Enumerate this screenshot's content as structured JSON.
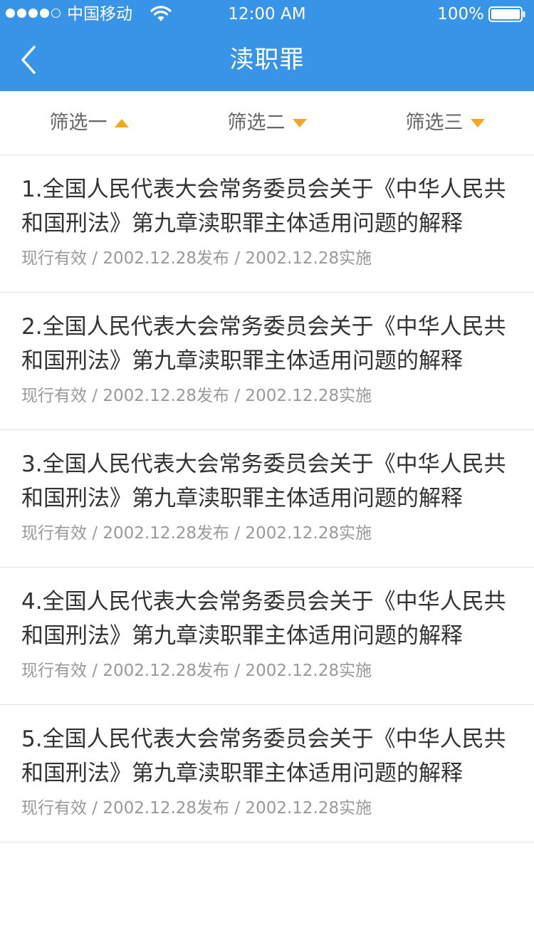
{
  "status_bar": {
    "carrier": "中国移动",
    "time": "12:00 AM",
    "battery": "100%"
  },
  "nav": {
    "title": "渎职罪",
    "back_icon": "chevron-left-icon"
  },
  "filters": [
    {
      "label": "筛选一",
      "icon": "triangle-up-icon"
    },
    {
      "label": "筛选二",
      "icon": "triangle-down-icon"
    },
    {
      "label": "筛选三",
      "icon": "triangle-down-icon"
    }
  ],
  "items": [
    {
      "title": "1.全国人民代表大会常务委员会关于《中华人民共和国刑法》第九章渎职罪主体适用问题的解释",
      "meta": "现行有效 / 2002.12.28发布 / 2002.12.28实施"
    },
    {
      "title": "2.全国人民代表大会常务委员会关于《中华人民共和国刑法》第九章渎职罪主体适用问题的解释",
      "meta": "现行有效 / 2002.12.28发布 / 2002.12.28实施"
    },
    {
      "title": "3.全国人民代表大会常务委员会关于《中华人民共和国刑法》第九章渎职罪主体适用问题的解释",
      "meta": "现行有效 / 2002.12.28发布 / 2002.12.28实施"
    },
    {
      "title": "4.全国人民代表大会常务委员会关于《中华人民共和国刑法》第九章渎职罪主体适用问题的解释",
      "meta": "现行有效 / 2002.12.28发布 / 2002.12.28实施"
    },
    {
      "title": "5.全国人民代表大会常务委员会关于《中华人民共和国刑法》第九章渎职罪主体适用问题的解释",
      "meta": "现行有效 / 2002.12.28发布 / 2002.12.28实施"
    }
  ],
  "colors": {
    "accent": "#3894e6",
    "filter_arrow": "#f5a623",
    "title_text": "#333333",
    "meta_text": "#999999"
  }
}
